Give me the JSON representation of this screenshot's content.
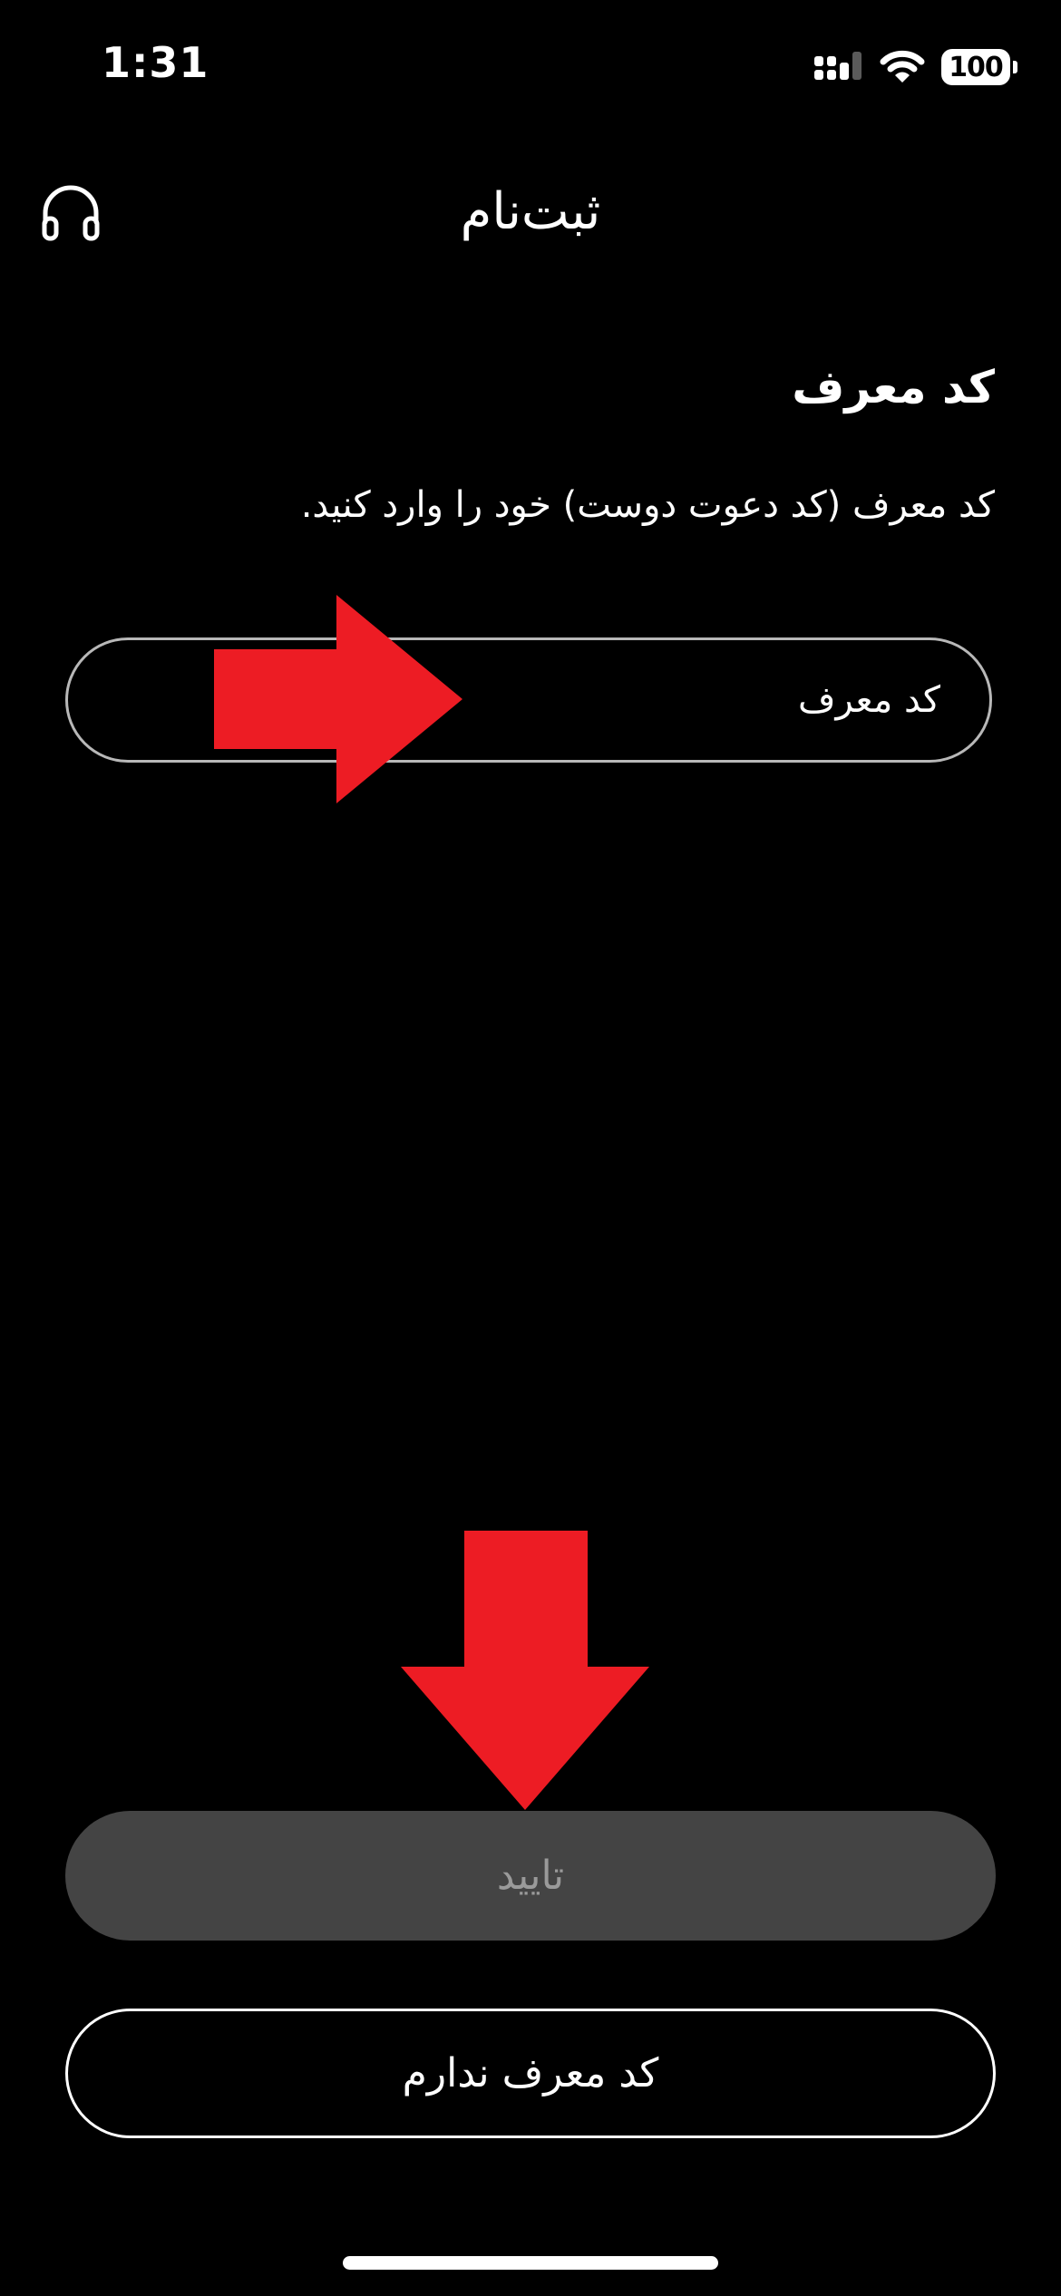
{
  "status_bar": {
    "time": "1:31",
    "battery_level": "100"
  },
  "header": {
    "title": "ثبت‌نام",
    "support_icon": "headphones-icon"
  },
  "referral": {
    "section_title": "کد معرف",
    "instruction": "کد معرف (کد دعوت دوست) خود را وارد کنید.",
    "input_placeholder": "کد معرف",
    "input_value": ""
  },
  "actions": {
    "confirm_label": "تایید",
    "no_code_label": "کد معرف ندارم"
  },
  "annotations": {
    "arrow_color": "#ed1c24",
    "arrows": [
      "arrow-right-icon",
      "arrow-down-icon"
    ]
  },
  "colors": {
    "background": "#000000",
    "text": "#ffffff",
    "disabled_button": "#444444",
    "disabled_text": "#9a9a9a"
  }
}
